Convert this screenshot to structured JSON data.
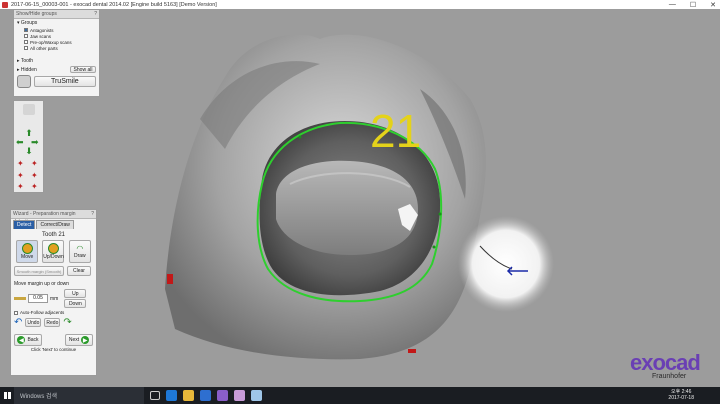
{
  "window": {
    "title": "2017-06-15_00003-001 - exocad dental 2014.02 [Engine build 5163] [Demo Version]",
    "minimize": "—",
    "maximize": "☐",
    "close": "✕"
  },
  "show_hide": {
    "header": "Show/Hide groups",
    "help": "?",
    "groups_label": "Groups",
    "items": [
      {
        "label": "Antagonists",
        "checked": true
      },
      {
        "label": "Jaw scans",
        "checked": false
      },
      {
        "label": "Pre-op/Waxup scans",
        "checked": false
      },
      {
        "label": "All other parts",
        "checked": false
      }
    ],
    "tooth_label": "Tooth",
    "hidden_label": "Hidden",
    "show_all": "Show all",
    "trusmile": "TruSmile"
  },
  "viewport": {
    "tooth_number": "21"
  },
  "wizard": {
    "header": "Wizard - Preparation margin detection",
    "help": "?",
    "tab_detect": "Detect",
    "tab_correct": "Correct/Draw",
    "tooth_title": "Tooth 21",
    "move": "Move",
    "updown": "Up/Down",
    "draw": "Draw",
    "smooth": "Smooth margin (Smooth)",
    "clear": "Clear",
    "move_margin_label": "Move margin up or down",
    "mm_value": "0.05",
    "mm_unit": "mm",
    "up": "Up",
    "down": "Down",
    "autofollow": "Auto-Follow adjacents",
    "undo": "Undo",
    "redo": "Redo",
    "back": "Back",
    "next": "Next",
    "hint": "Click 'Next' to continue"
  },
  "taskbar": {
    "search_placeholder": "Windows 검색",
    "time": "오후 2:46",
    "date": "2017-07-18"
  },
  "logo": {
    "brand": "exocad",
    "sub": "Fraunhofer"
  },
  "colors": {
    "margin": "#2ecf2e",
    "tooth_label": "#e4d21a",
    "logo": "#6a3fb4",
    "tab_active": "#2b5fa5"
  }
}
